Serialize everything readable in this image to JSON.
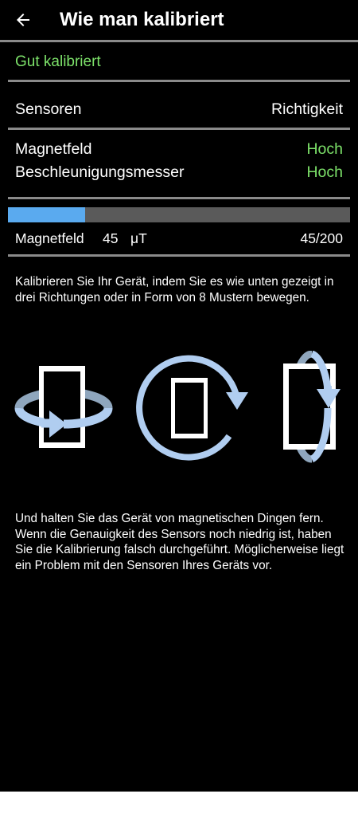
{
  "header": {
    "title": "Wie man kalibriert",
    "back_icon": "arrow-left-icon"
  },
  "status": {
    "text": "Gut kalibriert",
    "color": "#7de26a"
  },
  "sensors_table": {
    "header_label": "Sensoren",
    "header_value": "Richtigkeit",
    "rows": [
      {
        "label": "Magnetfeld",
        "value": "Hoch"
      },
      {
        "label": "Beschleunigungsmesser",
        "value": "Hoch"
      }
    ]
  },
  "magnetic": {
    "label": "Magnetfeld",
    "value": "45",
    "unit": "μT",
    "progress_text": "45/200",
    "progress_fraction": 0.225,
    "bar_color": "#5aaaef",
    "track_color": "#5a5a5a"
  },
  "instructions": {
    "text": "Kalibrieren Sie Ihr Gerät, indem Sie es wie unten gezeigt in drei Richtungen oder in Form von 8 Mustern bewegen."
  },
  "illustrations": [
    {
      "name": "horizontal-rotation-icon"
    },
    {
      "name": "screen-plane-rotation-icon"
    },
    {
      "name": "vertical-rotation-icon"
    }
  ],
  "note": {
    "text": "Und halten Sie das Gerät von magnetischen Dingen fern. Wenn die Genauigkeit des Sensors noch niedrig ist, haben Sie die Kalibrierung falsch durchgeführt. Möglicherweise liegt ein Problem mit den Sensoren Ihres Geräts vor."
  }
}
